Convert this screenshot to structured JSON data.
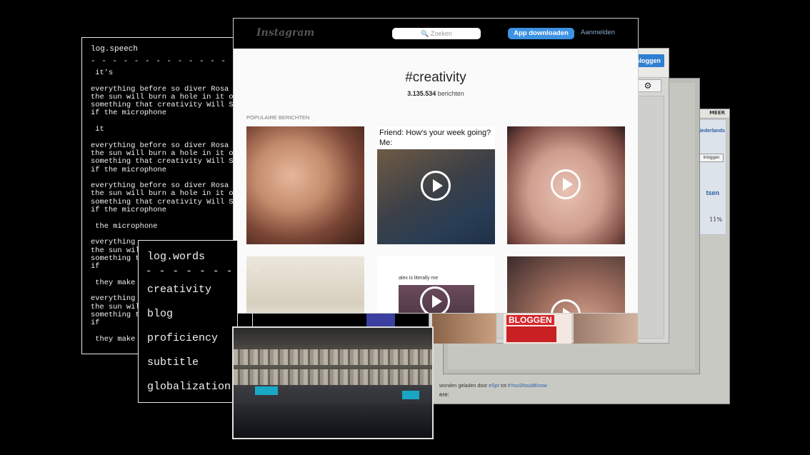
{
  "speech_window": {
    "title": "log.speech",
    "separator": "- - - - - - - - - - - - - - - - -",
    "lines": [
      " it's",
      "",
      "everything before so diver Rosa p",
      "the sun will burn a hole in it ok",
      "something that creativity Will So",
      "if the microphone",
      "",
      " it",
      "",
      "everything before so diver Rosa p",
      "the sun will burn a hole in it ok",
      "something that creativity Will So",
      "if the microphone",
      "",
      "everything before so diver Rosa p",
      "the sun will burn a hole in it ok",
      "something that creativity Will So",
      "if the microphone",
      "",
      " the microphone",
      "",
      "everything",
      "the sun wil",
      "something t",
      "if",
      "",
      " they make",
      "",
      "everything",
      "the sun wil",
      "something t",
      "if",
      "",
      " they make"
    ]
  },
  "words_window": {
    "title": "log.words",
    "separator": "- - - - - - - - -",
    "words": [
      "creativity",
      "blog",
      "proficiency",
      "subtitle",
      "globalization"
    ]
  },
  "instagram": {
    "logo": "Instagram",
    "search_placeholder": "🔍 Zoeken",
    "download_button": "App downloaden",
    "login_link": "Aanmelden",
    "hashtag": "#creativity",
    "post_count": "3.135.534",
    "post_count_suffix": "berichten",
    "section_label": "POPULAIRE BERICHTEN",
    "tile2_caption_line1": "Friend: How's your week going?",
    "tile2_caption_line2": "Me:",
    "tile5_caption": "alex is literally me"
  },
  "bg_windows": {
    "inloggen_button": "nloggen",
    "gear_icon": "⚙",
    "meer_label": "MEER",
    "nederlands_label": "Nederlands",
    "inloggen_small": "Inloggen",
    "partial_text": "tsen",
    "percent": "11%",
    "byline_text": "wonden geladen door ",
    "byline_user": "eSpr",
    "byline_mid": " tot ",
    "byline_link": "#YouShouldKnow",
    "partial_bottom": "ere:",
    "strip_banner": "BLOGGEN"
  }
}
